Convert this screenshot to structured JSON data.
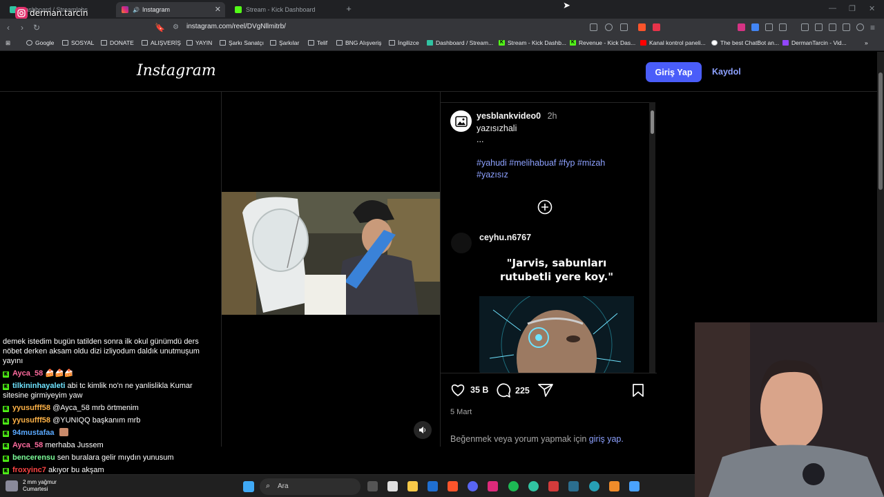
{
  "browser": {
    "tabs": [
      {
        "title": "Dashboard / Streamlabs",
        "active": false
      },
      {
        "title": "Instagram",
        "active": true
      },
      {
        "title": "Stream - Kick Dashboard",
        "active": false
      }
    ],
    "url": "instagram.com/reel/DVgNllmitrb/",
    "bookmarks": [
      "Google",
      "SOSYAL",
      "DONATE",
      "ALIŞVERİŞ",
      "YAYIN",
      "Şarkı Sanatçı",
      "Şarkılar",
      "Telif",
      "BNG Alışveriş",
      "İngilizce",
      "Dashboard / Stream...",
      "Stream - Kick Dashb...",
      "Revenue - Kick Das...",
      "Kanal kontrol paneli...",
      "The best ChatBot an...",
      "DermanTarcin - Vid..."
    ]
  },
  "stream_overlay": {
    "channel": "derman.tarcin"
  },
  "instagram": {
    "logo": "Instagram",
    "login_button": "Giriş Yap",
    "signup_link": "Kaydol",
    "post": {
      "author": "yesblankvideo0",
      "time": "2h",
      "caption_line1": "yazısızhali",
      "caption_line2": "...",
      "hashtags_line1": "#yahudi #melihabuaf #fyp #mizah",
      "hashtags_line2": "#yazısız",
      "comment_author": "ceyhu.n6767",
      "meme_text": "\"Jarvis, sabunları rutubetli yere koy.\"",
      "likes": "35 B",
      "comments_count": "225",
      "date": "5 Mart",
      "like_prompt": "Beğenmek veya yorum yapmak için",
      "like_prompt_link": "giriş yap."
    }
  },
  "chat": [
    {
      "user": "",
      "text": "demek istedim bugün tatilden sonra ilk okul günümdü ders nöbet derken aksam oldu dizi izliyodum daldık unutmuşum yayını",
      "color": "#ffffff"
    },
    {
      "user": "Ayca_58",
      "text": "🍰🍰🍰",
      "color": "#ff6b9e"
    },
    {
      "user": "tilkininhayaleti",
      "text": "abi tc kimlik no'n ne yanlislikla Kumar sitesine girmiyeyim yaw",
      "color": "#6fe3ff"
    },
    {
      "user": "yyusufff58",
      "text": "@Ayca_58 mrb örtmenim",
      "color": "#ffb347"
    },
    {
      "user": "yyusufff58",
      "text": "@YUNIQQ başkanım mrb",
      "color": "#ffb347"
    },
    {
      "user": "94mustafaa",
      "text": "",
      "color": "#5aa9ff"
    },
    {
      "user": "Ayca_58",
      "text": "merhaba Jussem",
      "color": "#ff6b9e"
    },
    {
      "user": "bencerensu",
      "text": "sen buralara gelir mıydın yunusum",
      "color": "#7dff9a"
    },
    {
      "user": "froxyinc7",
      "text": "akıyor bu akşam",
      "color": "#ff4444"
    }
  ],
  "taskbar": {
    "weather_line1": "2 mm yağmur",
    "weather_line2": "Cumartesi",
    "search_label": "Ara"
  },
  "colors": {
    "ig_blue": "#4a5df9",
    "link_blue": "#8da1ff",
    "kick_green": "#53fc18"
  }
}
